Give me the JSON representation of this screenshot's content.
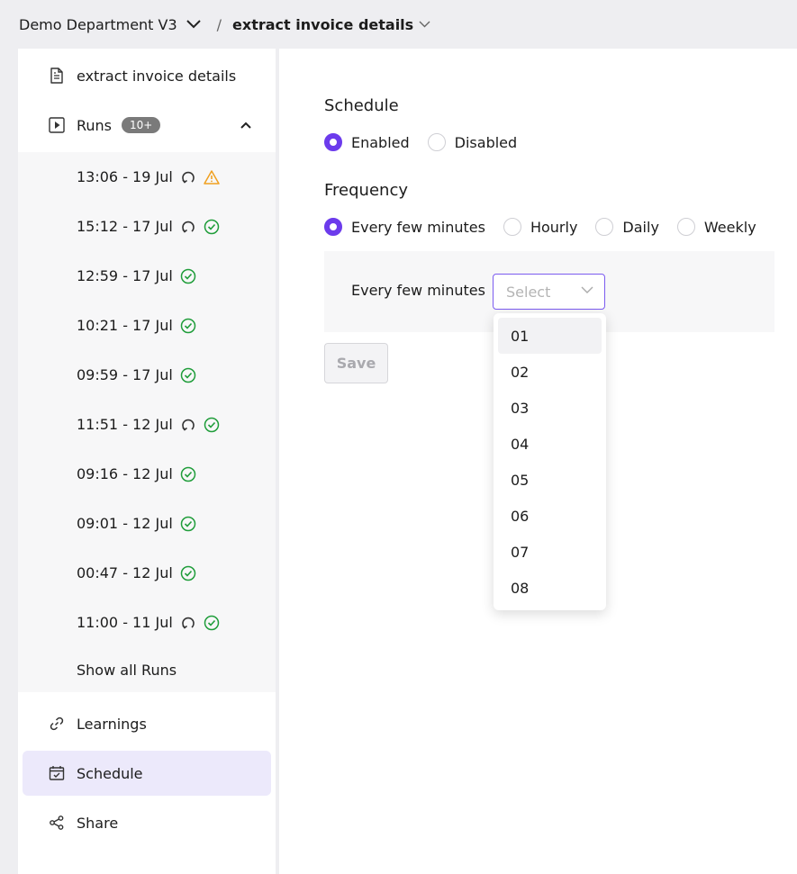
{
  "breadcrumb": {
    "department": "Demo Department V3",
    "separator": "/",
    "page": "extract invoice details"
  },
  "sidebar": {
    "document_label": "extract invoice details",
    "runs_label": "Runs",
    "runs_badge": "10+",
    "runs": [
      {
        "label": "13:06 - 19 Jul",
        "retried": true,
        "status": "warning"
      },
      {
        "label": "15:12 - 17 Jul",
        "retried": true,
        "status": "success"
      },
      {
        "label": "12:59 - 17 Jul",
        "retried": false,
        "status": "success"
      },
      {
        "label": "10:21 - 17 Jul",
        "retried": false,
        "status": "success"
      },
      {
        "label": "09:59 - 17 Jul",
        "retried": false,
        "status": "success"
      },
      {
        "label": "11:51 - 12 Jul",
        "retried": true,
        "status": "success"
      },
      {
        "label": "09:16 - 12 Jul",
        "retried": false,
        "status": "success"
      },
      {
        "label": "09:01 - 12 Jul",
        "retried": false,
        "status": "success"
      },
      {
        "label": "00:47 - 12 Jul",
        "retried": false,
        "status": "success"
      },
      {
        "label": "11:00 - 11 Jul",
        "retried": true,
        "status": "success"
      }
    ],
    "show_all_label": "Show all Runs",
    "learnings_label": "Learnings",
    "schedule_label": "Schedule",
    "share_label": "Share"
  },
  "schedule": {
    "title": "Schedule",
    "enabled_label": "Enabled",
    "disabled_label": "Disabled",
    "selected": "enabled"
  },
  "frequency": {
    "title": "Frequency",
    "options": [
      "Every few minutes",
      "Hourly",
      "Daily",
      "Weekly"
    ],
    "selected": "Every few minutes",
    "field_label": "Every few minutes",
    "select_placeholder": "Select"
  },
  "save_label": "Save",
  "dropdown_options": [
    "01",
    "02",
    "03",
    "04",
    "05",
    "06",
    "07",
    "08"
  ],
  "colors": {
    "accent": "#6c3bec",
    "success": "#1f9d3a",
    "warning": "#f0a020",
    "active_bg": "#ece9fb"
  },
  "icons": {
    "document": "file-text-icon",
    "runs": "play-square-icon",
    "learnings": "link-icon",
    "schedule": "calendar-check-icon",
    "share": "share-icon",
    "retry": "retry-icon",
    "success": "check-circle-icon",
    "warning": "warning-triangle-icon"
  }
}
